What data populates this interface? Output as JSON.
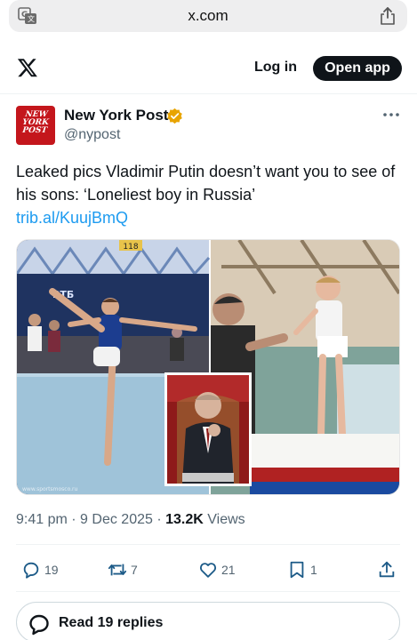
{
  "browser": {
    "url": "x.com",
    "translate_icon": "translate-icon",
    "share_icon": "share-icon"
  },
  "header": {
    "logo": "x-logo-icon",
    "login_label": "Log in",
    "open_app_label": "Open app"
  },
  "author": {
    "name": "New York Post",
    "handle": "@nypost",
    "avatar_text": "NEW YORK POST",
    "verified": true,
    "verified_color": "#f4b400"
  },
  "tweet": {
    "text": "Leaked pics Vladimir Putin doesn’t want you to see of his sons: ‘Loneliest boy in Russia’",
    "link": "trib.al/KuujBmQ",
    "media_watermark": "www.sportsmosco.ru",
    "media_sign_text": "ВТБ",
    "media_number": "118"
  },
  "meta": {
    "time": "9:41 pm",
    "date": "9 Dec 2025",
    "views_count": "13.2K",
    "views_label": "Views"
  },
  "actions": {
    "replies": "19",
    "reposts": "7",
    "likes": "21",
    "bookmarks": "1"
  },
  "read_replies": {
    "label": "Read 19 replies"
  },
  "colors": {
    "link": "#1d9bf0",
    "text": "#0f1419",
    "secondary": "#536471",
    "brand_red": "#c4161c"
  }
}
